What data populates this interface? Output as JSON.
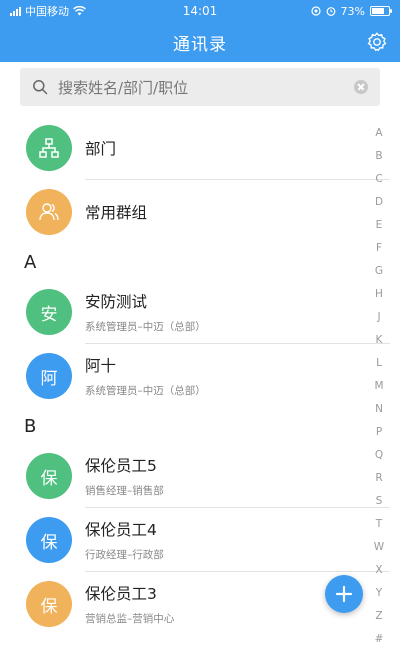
{
  "status_bar": {
    "carrier": "中国移动",
    "time": "14:01",
    "battery": "73%",
    "battery_fraction": 0.73
  },
  "header": {
    "title": "通讯录",
    "settings_icon": "gear-icon"
  },
  "search": {
    "placeholder": "搜索姓名/部门/职位",
    "icon": "search-icon"
  },
  "quick_entries": [
    {
      "label": "部门",
      "icon": "org-chart-icon",
      "color": "#4fc07f"
    },
    {
      "label": "常用群组",
      "icon": "group-icon",
      "color": "#f0b25a"
    }
  ],
  "sections": [
    {
      "letter": "A",
      "contacts": [
        {
          "avatar": "安",
          "name": "安防测试",
          "subtitle": "系统管理员–中迈（总部）",
          "color": "#4fc07f"
        },
        {
          "avatar": "阿",
          "name": "阿十",
          "subtitle": "系统管理员–中迈（总部）",
          "color": "#3d9bf0"
        }
      ]
    },
    {
      "letter": "B",
      "contacts": [
        {
          "avatar": "保",
          "name": "保伦员工5",
          "subtitle": "销售经理–销售部",
          "color": "#4fc07f"
        },
        {
          "avatar": "保",
          "name": "保伦员工4",
          "subtitle": "行政经理–行政部",
          "color": "#3d9bf0"
        },
        {
          "avatar": "保",
          "name": "保伦员工3",
          "subtitle": "营销总监–营销中心",
          "color": "#f0b25a"
        }
      ]
    }
  ],
  "index_letters": [
    "A",
    "B",
    "C",
    "D",
    "E",
    "F",
    "G",
    "H",
    "J",
    "K",
    "L",
    "M",
    "N",
    "P",
    "Q",
    "R",
    "S",
    "T",
    "W",
    "X",
    "Y",
    "Z",
    "#"
  ],
  "fab": {
    "label": "+",
    "icon": "plus-icon"
  },
  "colors": {
    "accent": "#3d9bf0",
    "green": "#4fc07f",
    "orange": "#f0b25a"
  }
}
